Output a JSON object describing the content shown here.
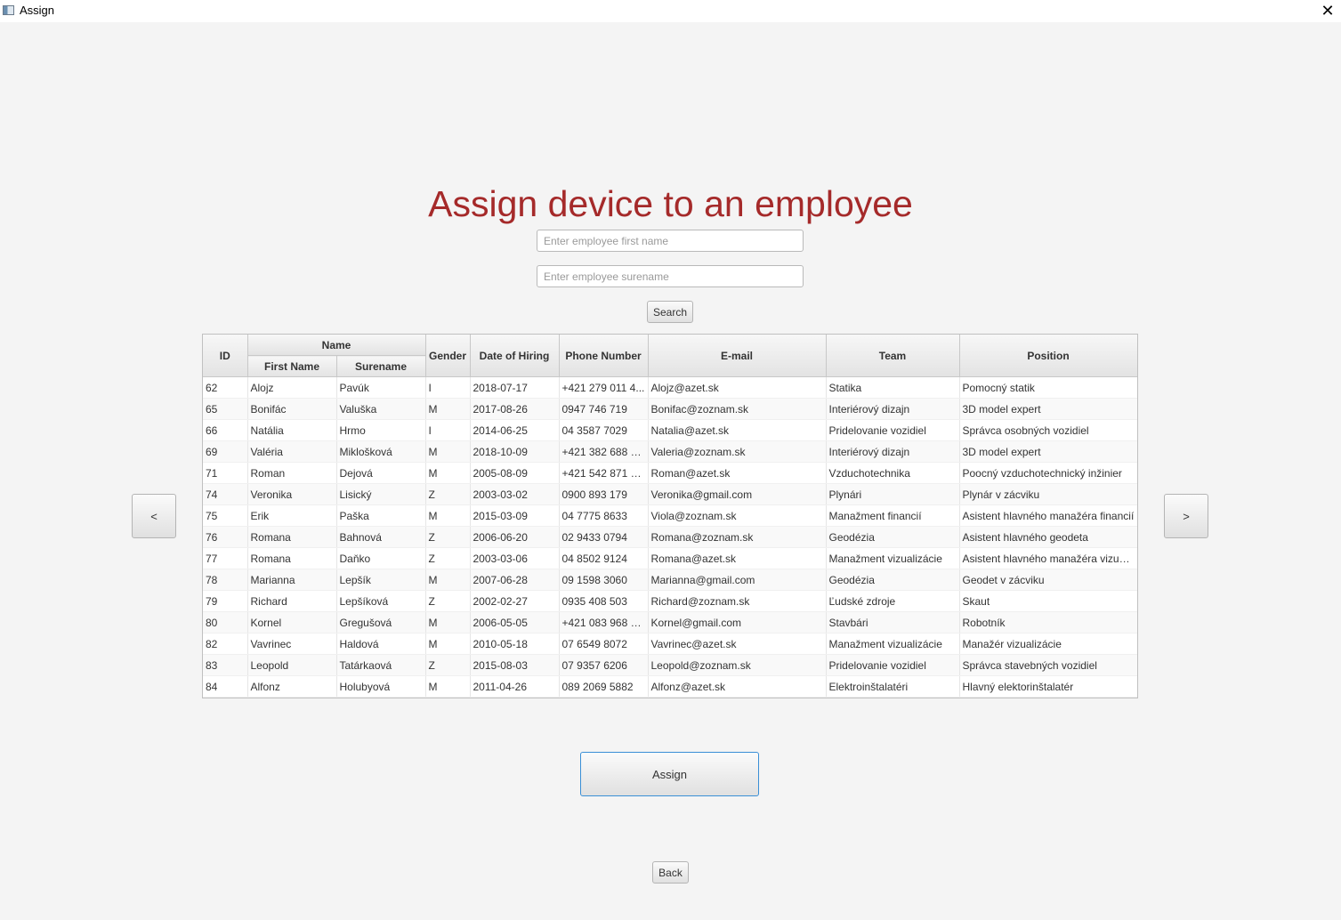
{
  "window": {
    "title": "Assign",
    "close_symbol": "✕"
  },
  "heading": "Assign device to an employee",
  "search": {
    "first_name_placeholder": "Enter employee first name",
    "surname_placeholder": "Enter employee surename",
    "search_label": "Search"
  },
  "table": {
    "headers": {
      "id": "ID",
      "name": "Name",
      "first_name": "First Name",
      "surname": "Surename",
      "gender": "Gender",
      "date_of_hiring": "Date of Hiring",
      "phone": "Phone Number",
      "email": "E-mail",
      "team": "Team",
      "position": "Position"
    },
    "rows": [
      {
        "id": "62",
        "first": "Alojz",
        "sur": "Pavúk",
        "gender": "I",
        "date": "2018-07-17",
        "phone": "+421 279 011 4...",
        "email": "Alojz@azet.sk",
        "team": "Statika",
        "position": "Pomocný statik"
      },
      {
        "id": "65",
        "first": "Bonifác",
        "sur": "Valuška",
        "gender": "M",
        "date": "2017-08-26",
        "phone": "0947 746 719",
        "email": "Bonifac@zoznam.sk",
        "team": "Interiérový dizajn",
        "position": "3D model expert"
      },
      {
        "id": "66",
        "first": "Natália",
        "sur": "Hrmo",
        "gender": "I",
        "date": "2014-06-25",
        "phone": "04 3587 7029",
        "email": "Natalia@azet.sk",
        "team": "Pridelovanie vozidiel",
        "position": "Správca osobných vozidiel"
      },
      {
        "id": "69",
        "first": "Valéria",
        "sur": "Miklošková",
        "gender": "M",
        "date": "2018-10-09",
        "phone": "+421 382 688 1...",
        "email": "Valeria@zoznam.sk",
        "team": "Interiérový dizajn",
        "position": "3D model expert"
      },
      {
        "id": "71",
        "first": "Roman",
        "sur": "Dejová",
        "gender": "M",
        "date": "2005-08-09",
        "phone": "+421 542 871 2...",
        "email": "Roman@azet.sk",
        "team": "Vzduchotechnika",
        "position": "Poocný vzduchotechnický inžinier"
      },
      {
        "id": "74",
        "first": "Veronika",
        "sur": "Lisický",
        "gender": "Z",
        "date": "2003-03-02",
        "phone": "0900 893 179",
        "email": "Veronika@gmail.com",
        "team": "Plynári",
        "position": "Plynár v zácviku"
      },
      {
        "id": "75",
        "first": "Erik",
        "sur": "Paška",
        "gender": "M",
        "date": "2015-03-09",
        "phone": "04 7775 8633",
        "email": "Viola@zoznam.sk",
        "team": "Manažment financií",
        "position": "Asistent hlavného manažéra financií"
      },
      {
        "id": "76",
        "first": "Romana",
        "sur": "Bahnová",
        "gender": "Z",
        "date": "2006-06-20",
        "phone": "02 9433 0794",
        "email": "Romana@zoznam.sk",
        "team": "Geodézia",
        "position": "Asistent hlavného geodeta"
      },
      {
        "id": "77",
        "first": "Romana",
        "sur": "Daňko",
        "gender": "Z",
        "date": "2003-03-06",
        "phone": "04 8502 9124",
        "email": "Romana@azet.sk",
        "team": "Manažment vizualizácie",
        "position": "Asistent hlavného manažéra vizual..."
      },
      {
        "id": "78",
        "first": "Marianna",
        "sur": "Lepšík",
        "gender": "M",
        "date": "2007-06-28",
        "phone": "09 1598 3060",
        "email": "Marianna@gmail.com",
        "team": "Geodézia",
        "position": "Geodet v zácviku"
      },
      {
        "id": "79",
        "first": "Richard",
        "sur": "Lepšíková",
        "gender": "Z",
        "date": "2002-02-27",
        "phone": "0935 408 503",
        "email": "Richard@zoznam.sk",
        "team": "Ľudské zdroje",
        "position": "Skaut"
      },
      {
        "id": "80",
        "first": "Kornel",
        "sur": "Gregušová",
        "gender": "M",
        "date": "2006-05-05",
        "phone": "+421 083 968 2...",
        "email": "Kornel@gmail.com",
        "team": "Stavbári",
        "position": "Robotník"
      },
      {
        "id": "82",
        "first": "Vavrinec",
        "sur": "Haldová",
        "gender": "M",
        "date": "2010-05-18",
        "phone": "07 6549 8072",
        "email": "Vavrinec@azet.sk",
        "team": "Manažment vizualizácie",
        "position": "Manažér vizualizácie"
      },
      {
        "id": "83",
        "first": "Leopold",
        "sur": "Tatárkaová",
        "gender": "Z",
        "date": "2015-08-03",
        "phone": "07 9357 6206",
        "email": "Leopold@zoznam.sk",
        "team": "Pridelovanie vozidiel",
        "position": "Správca stavebných vozidiel"
      },
      {
        "id": "84",
        "first": "Alfonz",
        "sur": "Holubyová",
        "gender": "M",
        "date": "2011-04-26",
        "phone": "089 2069 5882",
        "email": "Alfonz@azet.sk",
        "team": "Elektroinštalatéri",
        "position": "Hlavný elektorinštalatér"
      }
    ]
  },
  "nav": {
    "prev_label": "<",
    "next_label": ">"
  },
  "actions": {
    "assign_label": "Assign",
    "back_label": "Back"
  }
}
